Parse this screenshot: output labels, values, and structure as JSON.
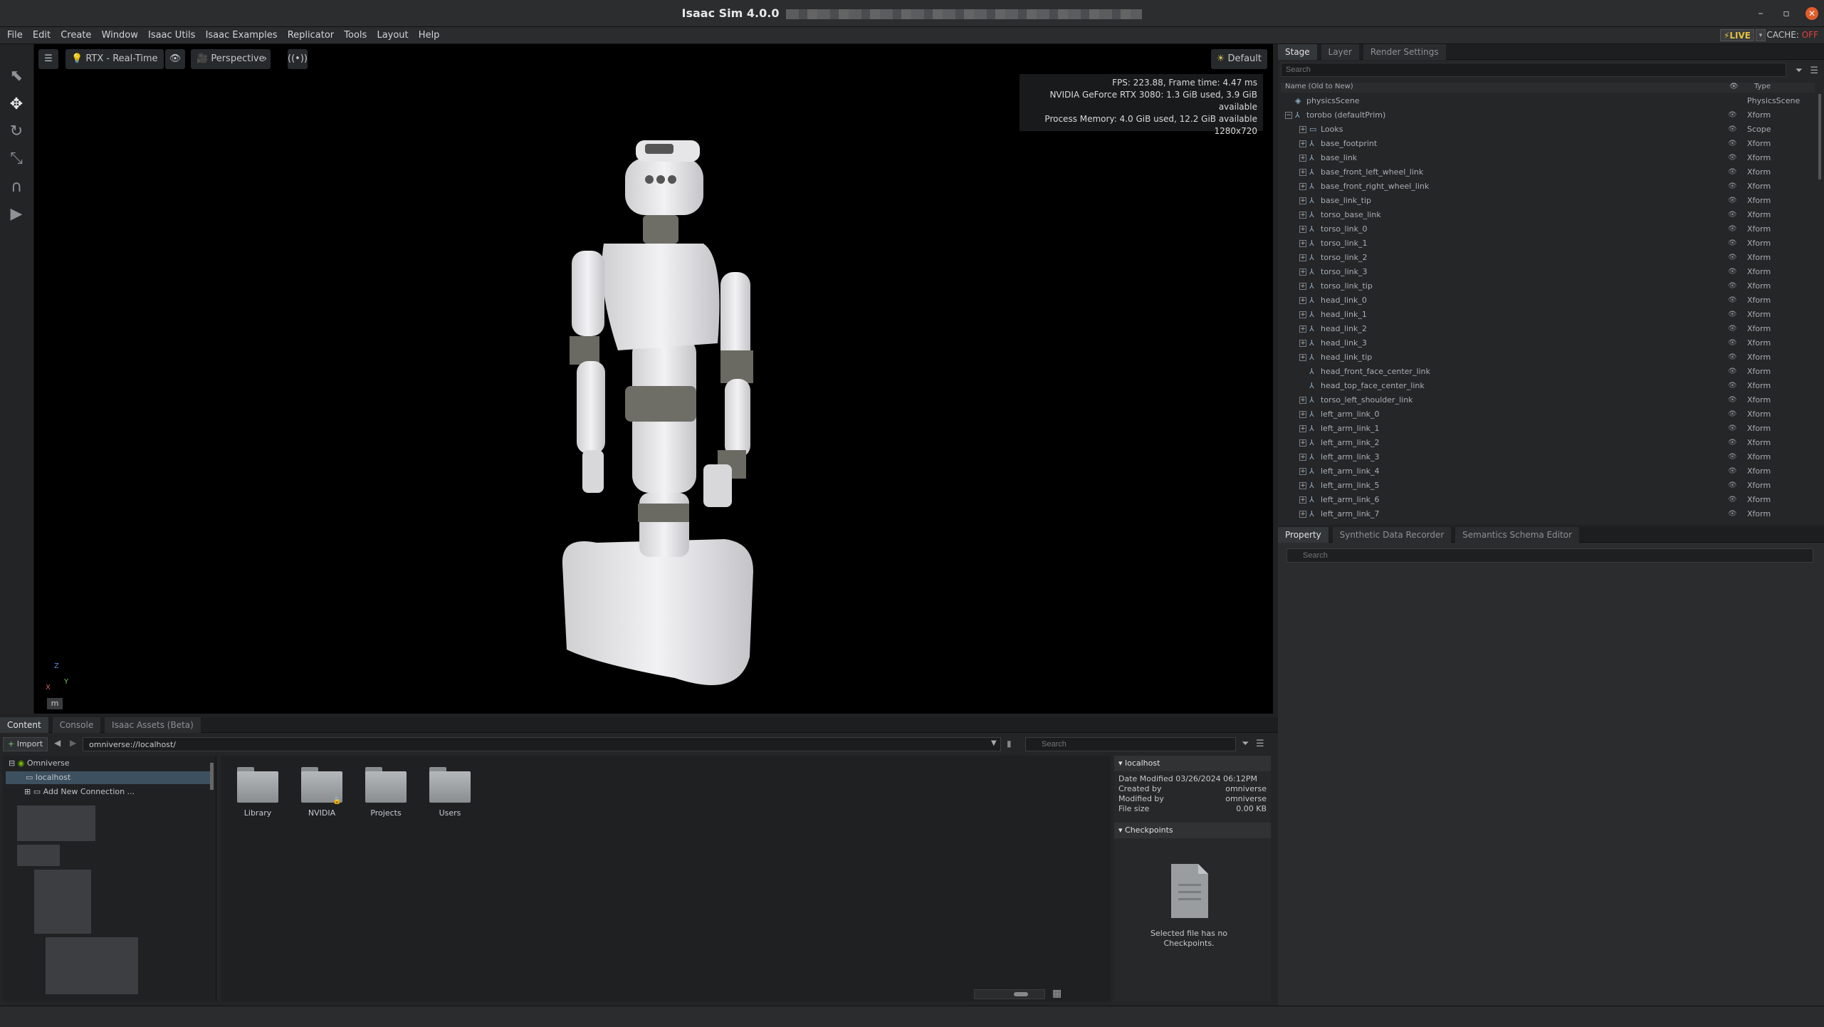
{
  "window": {
    "title": "Isaac Sim 4.0.0",
    "min_icon": "minimize-icon",
    "max_icon": "maximize-icon",
    "close_icon": "close-icon"
  },
  "menu": [
    "File",
    "Edit",
    "Create",
    "Window",
    "Isaac Utils",
    "Isaac Examples",
    "Replicator",
    "Tools",
    "Layout",
    "Help"
  ],
  "live": {
    "label": "LIVE",
    "cache_label": "CACHE:",
    "cache_state": "OFF"
  },
  "viewport": {
    "renderer": "RTX - Real-Time",
    "camera": "Perspective",
    "lighting": "Default",
    "hud": {
      "fps": "FPS: 223.88, Frame time: 4.47 ms",
      "gpu": "NVIDIA GeForce RTX 3080: 1.3 GiB used, 3.9 GiB available",
      "process": "Process Memory: 4.0 GiB used, 12.2 GiB available",
      "resolution": "1280x720"
    },
    "unit": "m",
    "axes": {
      "x": "X",
      "y": "Y",
      "z": "Z"
    }
  },
  "stage": {
    "tabs": [
      "Stage",
      "Layer",
      "Render Settings"
    ],
    "search_placeholder": "Search",
    "col_name": "Name (Old to New)",
    "col_type": "Type",
    "rows": [
      {
        "name": "physicsScene",
        "type": "PhysicsScene",
        "depth": 0,
        "exp": ""
      },
      {
        "name": "torobo (defaultPrim)",
        "type": "Xform",
        "depth": 0,
        "exp": "-"
      },
      {
        "name": "Looks",
        "type": "Scope",
        "depth": 1,
        "exp": "+"
      },
      {
        "name": "base_footprint",
        "type": "Xform",
        "depth": 1,
        "exp": "+"
      },
      {
        "name": "base_link",
        "type": "Xform",
        "depth": 1,
        "exp": "+"
      },
      {
        "name": "base_front_left_wheel_link",
        "type": "Xform",
        "depth": 1,
        "exp": "+"
      },
      {
        "name": "base_front_right_wheel_link",
        "type": "Xform",
        "depth": 1,
        "exp": "+"
      },
      {
        "name": "base_link_tip",
        "type": "Xform",
        "depth": 1,
        "exp": "+"
      },
      {
        "name": "torso_base_link",
        "type": "Xform",
        "depth": 1,
        "exp": "+"
      },
      {
        "name": "torso_link_0",
        "type": "Xform",
        "depth": 1,
        "exp": "+"
      },
      {
        "name": "torso_link_1",
        "type": "Xform",
        "depth": 1,
        "exp": "+"
      },
      {
        "name": "torso_link_2",
        "type": "Xform",
        "depth": 1,
        "exp": "+"
      },
      {
        "name": "torso_link_3",
        "type": "Xform",
        "depth": 1,
        "exp": "+"
      },
      {
        "name": "torso_link_tip",
        "type": "Xform",
        "depth": 1,
        "exp": "+"
      },
      {
        "name": "head_link_0",
        "type": "Xform",
        "depth": 1,
        "exp": "+"
      },
      {
        "name": "head_link_1",
        "type": "Xform",
        "depth": 1,
        "exp": "+"
      },
      {
        "name": "head_link_2",
        "type": "Xform",
        "depth": 1,
        "exp": "+"
      },
      {
        "name": "head_link_3",
        "type": "Xform",
        "depth": 1,
        "exp": "+"
      },
      {
        "name": "head_link_tip",
        "type": "Xform",
        "depth": 1,
        "exp": "+"
      },
      {
        "name": "head_front_face_center_link",
        "type": "Xform",
        "depth": 1,
        "exp": ""
      },
      {
        "name": "head_top_face_center_link",
        "type": "Xform",
        "depth": 1,
        "exp": ""
      },
      {
        "name": "torso_left_shoulder_link",
        "type": "Xform",
        "depth": 1,
        "exp": "+"
      },
      {
        "name": "left_arm_link_0",
        "type": "Xform",
        "depth": 1,
        "exp": "+"
      },
      {
        "name": "left_arm_link_1",
        "type": "Xform",
        "depth": 1,
        "exp": "+"
      },
      {
        "name": "left_arm_link_2",
        "type": "Xform",
        "depth": 1,
        "exp": "+"
      },
      {
        "name": "left_arm_link_3",
        "type": "Xform",
        "depth": 1,
        "exp": "+"
      },
      {
        "name": "left_arm_link_4",
        "type": "Xform",
        "depth": 1,
        "exp": "+"
      },
      {
        "name": "left_arm_link_5",
        "type": "Xform",
        "depth": 1,
        "exp": "+"
      },
      {
        "name": "left_arm_link_6",
        "type": "Xform",
        "depth": 1,
        "exp": "+"
      },
      {
        "name": "left_arm_link_7",
        "type": "Xform",
        "depth": 1,
        "exp": "+"
      }
    ]
  },
  "property": {
    "tabs": [
      "Property",
      "Synthetic Data Recorder",
      "Semantics Schema Editor"
    ],
    "search_placeholder": "Search"
  },
  "content": {
    "tabs": [
      "Content",
      "Console",
      "Isaac Assets (Beta)"
    ],
    "import_label": "Import",
    "path": "omniverse://localhost/",
    "search_placeholder": "Search",
    "tree": {
      "root": "Omniverse",
      "localhost": "localhost",
      "add": "Add New Connection ..."
    },
    "folders": [
      "Library",
      "NVIDIA",
      "Projects",
      "Users"
    ],
    "detail": {
      "title": "localhost",
      "date_label": "Date Modified",
      "date_value": "03/26/2024 06:12PM",
      "created_label": "Created by",
      "created_value": "omniverse",
      "modified_label": "Modified by",
      "modified_value": "omniverse",
      "size_label": "File size",
      "size_value": "0.00 KB",
      "checkpoints_title": "Checkpoints",
      "no_checkpoints": "Selected file has no Checkpoints."
    }
  }
}
